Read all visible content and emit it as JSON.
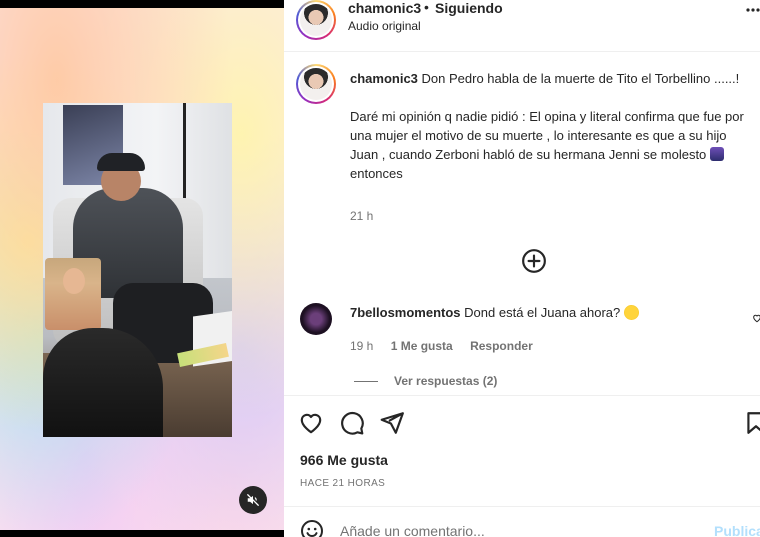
{
  "media": {
    "mute_icon": "speaker-muted-icon"
  },
  "header": {
    "username": "chamonic3",
    "separator": "•",
    "follow_status": "Siguiendo",
    "audio": "Audio original",
    "more_icon": "more-horizontal-icon"
  },
  "caption": {
    "username": "chamonic3",
    "line1": "Don Pedro habla de la muerte de Tito el Torbellino ......!",
    "line2_before_emoji": "Daré mi opinión q nadie pidió : El opina y literal confirma que fue por una mujer el motivo de su muerte , lo interesante es que a su hijo Juan , cuando Zerboni habló de su hermana Jenni se molesto",
    "line2_after_emoji": "entonces",
    "time": "21 h"
  },
  "load_more_icon": "plus-circle-icon",
  "comment": {
    "username": "7bellosmomentos",
    "text": "Dond está el Juana ahora?",
    "time": "19 h",
    "likes": "1 Me gusta",
    "reply": "Responder",
    "view_replies": "Ver respuestas (2)"
  },
  "actions": {
    "like_icon": "heart-icon",
    "comment_icon": "comment-icon",
    "share_icon": "paper-plane-icon",
    "save_icon": "bookmark-icon"
  },
  "likes": "966 Me gusta",
  "posted_ago": "HACE 21 HORAS",
  "add_comment": {
    "placeholder": "Añade un comentario...",
    "publish": "Publicar",
    "emoji_icon": "emoji-smile-icon"
  }
}
